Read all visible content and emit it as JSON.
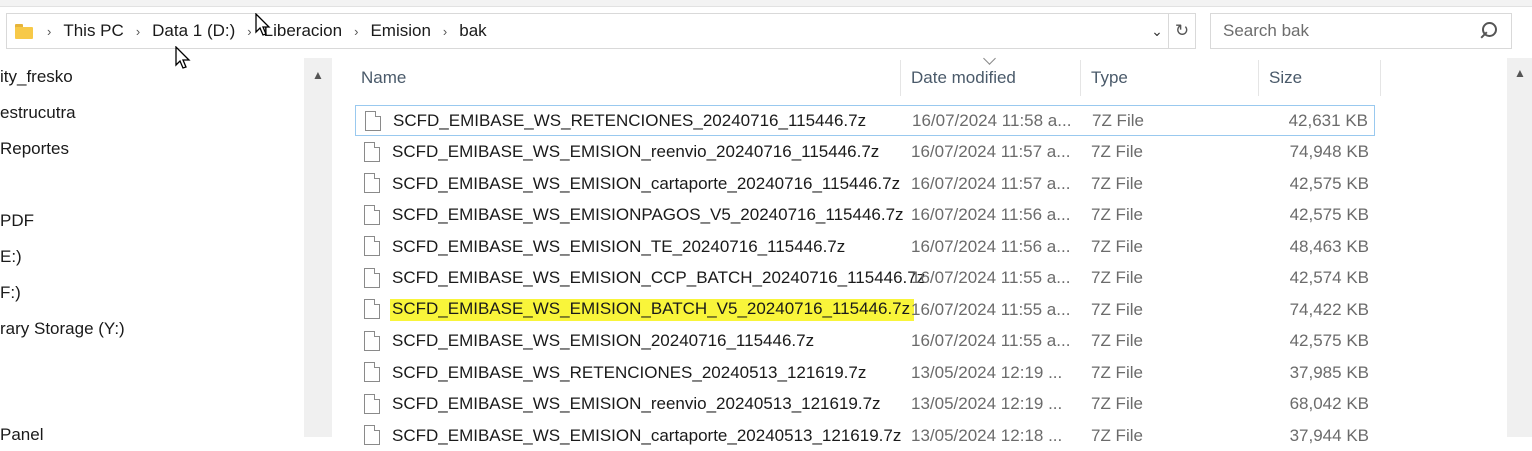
{
  "address": {
    "breadcrumbs": [
      "This PC",
      "Data 1 (D:)",
      "Liberacion",
      "Emision",
      "bak"
    ],
    "dropdown_icon": "chevron-down-icon",
    "refresh_icon": "refresh-icon"
  },
  "search": {
    "placeholder": "Search bak"
  },
  "nav": {
    "items": [
      "ity_fresko",
      "estrucutra",
      "Reportes",
      "PDF",
      "E:)",
      "F:)",
      "rary Storage (Y:)",
      "Panel"
    ]
  },
  "columns": {
    "name": "Name",
    "date": "Date modified",
    "type": "Type",
    "size": "Size"
  },
  "files": [
    {
      "name": "SCFD_EMIBASE_WS_RETENCIONES_20240716_115446.7z",
      "date": "16/07/2024 11:58 a...",
      "type": "7Z File",
      "size": "42,631 KB"
    },
    {
      "name": "SCFD_EMIBASE_WS_EMISION_reenvio_20240716_115446.7z",
      "date": "16/07/2024 11:57 a...",
      "type": "7Z File",
      "size": "74,948 KB"
    },
    {
      "name": "SCFD_EMIBASE_WS_EMISION_cartaporte_20240716_115446.7z",
      "date": "16/07/2024 11:57 a...",
      "type": "7Z File",
      "size": "42,575 KB"
    },
    {
      "name": "SCFD_EMIBASE_WS_EMISIONPAGOS_V5_20240716_115446.7z",
      "date": "16/07/2024 11:56 a...",
      "type": "7Z File",
      "size": "42,575 KB"
    },
    {
      "name": "SCFD_EMIBASE_WS_EMISION_TE_20240716_115446.7z",
      "date": "16/07/2024 11:56 a...",
      "type": "7Z File",
      "size": "48,463 KB"
    },
    {
      "name": "SCFD_EMIBASE_WS_EMISION_CCP_BATCH_20240716_115446.7z",
      "date": "16/07/2024 11:55 a...",
      "type": "7Z File",
      "size": "42,574 KB"
    },
    {
      "name": "SCFD_EMIBASE_WS_EMISION_BATCH_V5_20240716_115446.7z",
      "date": "16/07/2024 11:55 a...",
      "type": "7Z File",
      "size": "74,422 KB"
    },
    {
      "name": "SCFD_EMIBASE_WS_EMISION_20240716_115446.7z",
      "date": "16/07/2024 11:55 a...",
      "type": "7Z File",
      "size": "42,575 KB"
    },
    {
      "name": "SCFD_EMIBASE_WS_RETENCIONES_20240513_121619.7z",
      "date": "13/05/2024 12:19 ...",
      "type": "7Z File",
      "size": "37,985 KB"
    },
    {
      "name": "SCFD_EMIBASE_WS_EMISION_reenvio_20240513_121619.7z",
      "date": "13/05/2024 12:19 ...",
      "type": "7Z File",
      "size": "68,042 KB"
    },
    {
      "name": "SCFD_EMIBASE_WS_EMISION_cartaporte_20240513_121619.7z",
      "date": "13/05/2024 12:18 ...",
      "type": "7Z File",
      "size": "37,944 KB"
    }
  ],
  "colors": {
    "highlight": "#f9f53a",
    "selection_border": "#99c9ef",
    "folder": "#f7c948"
  }
}
